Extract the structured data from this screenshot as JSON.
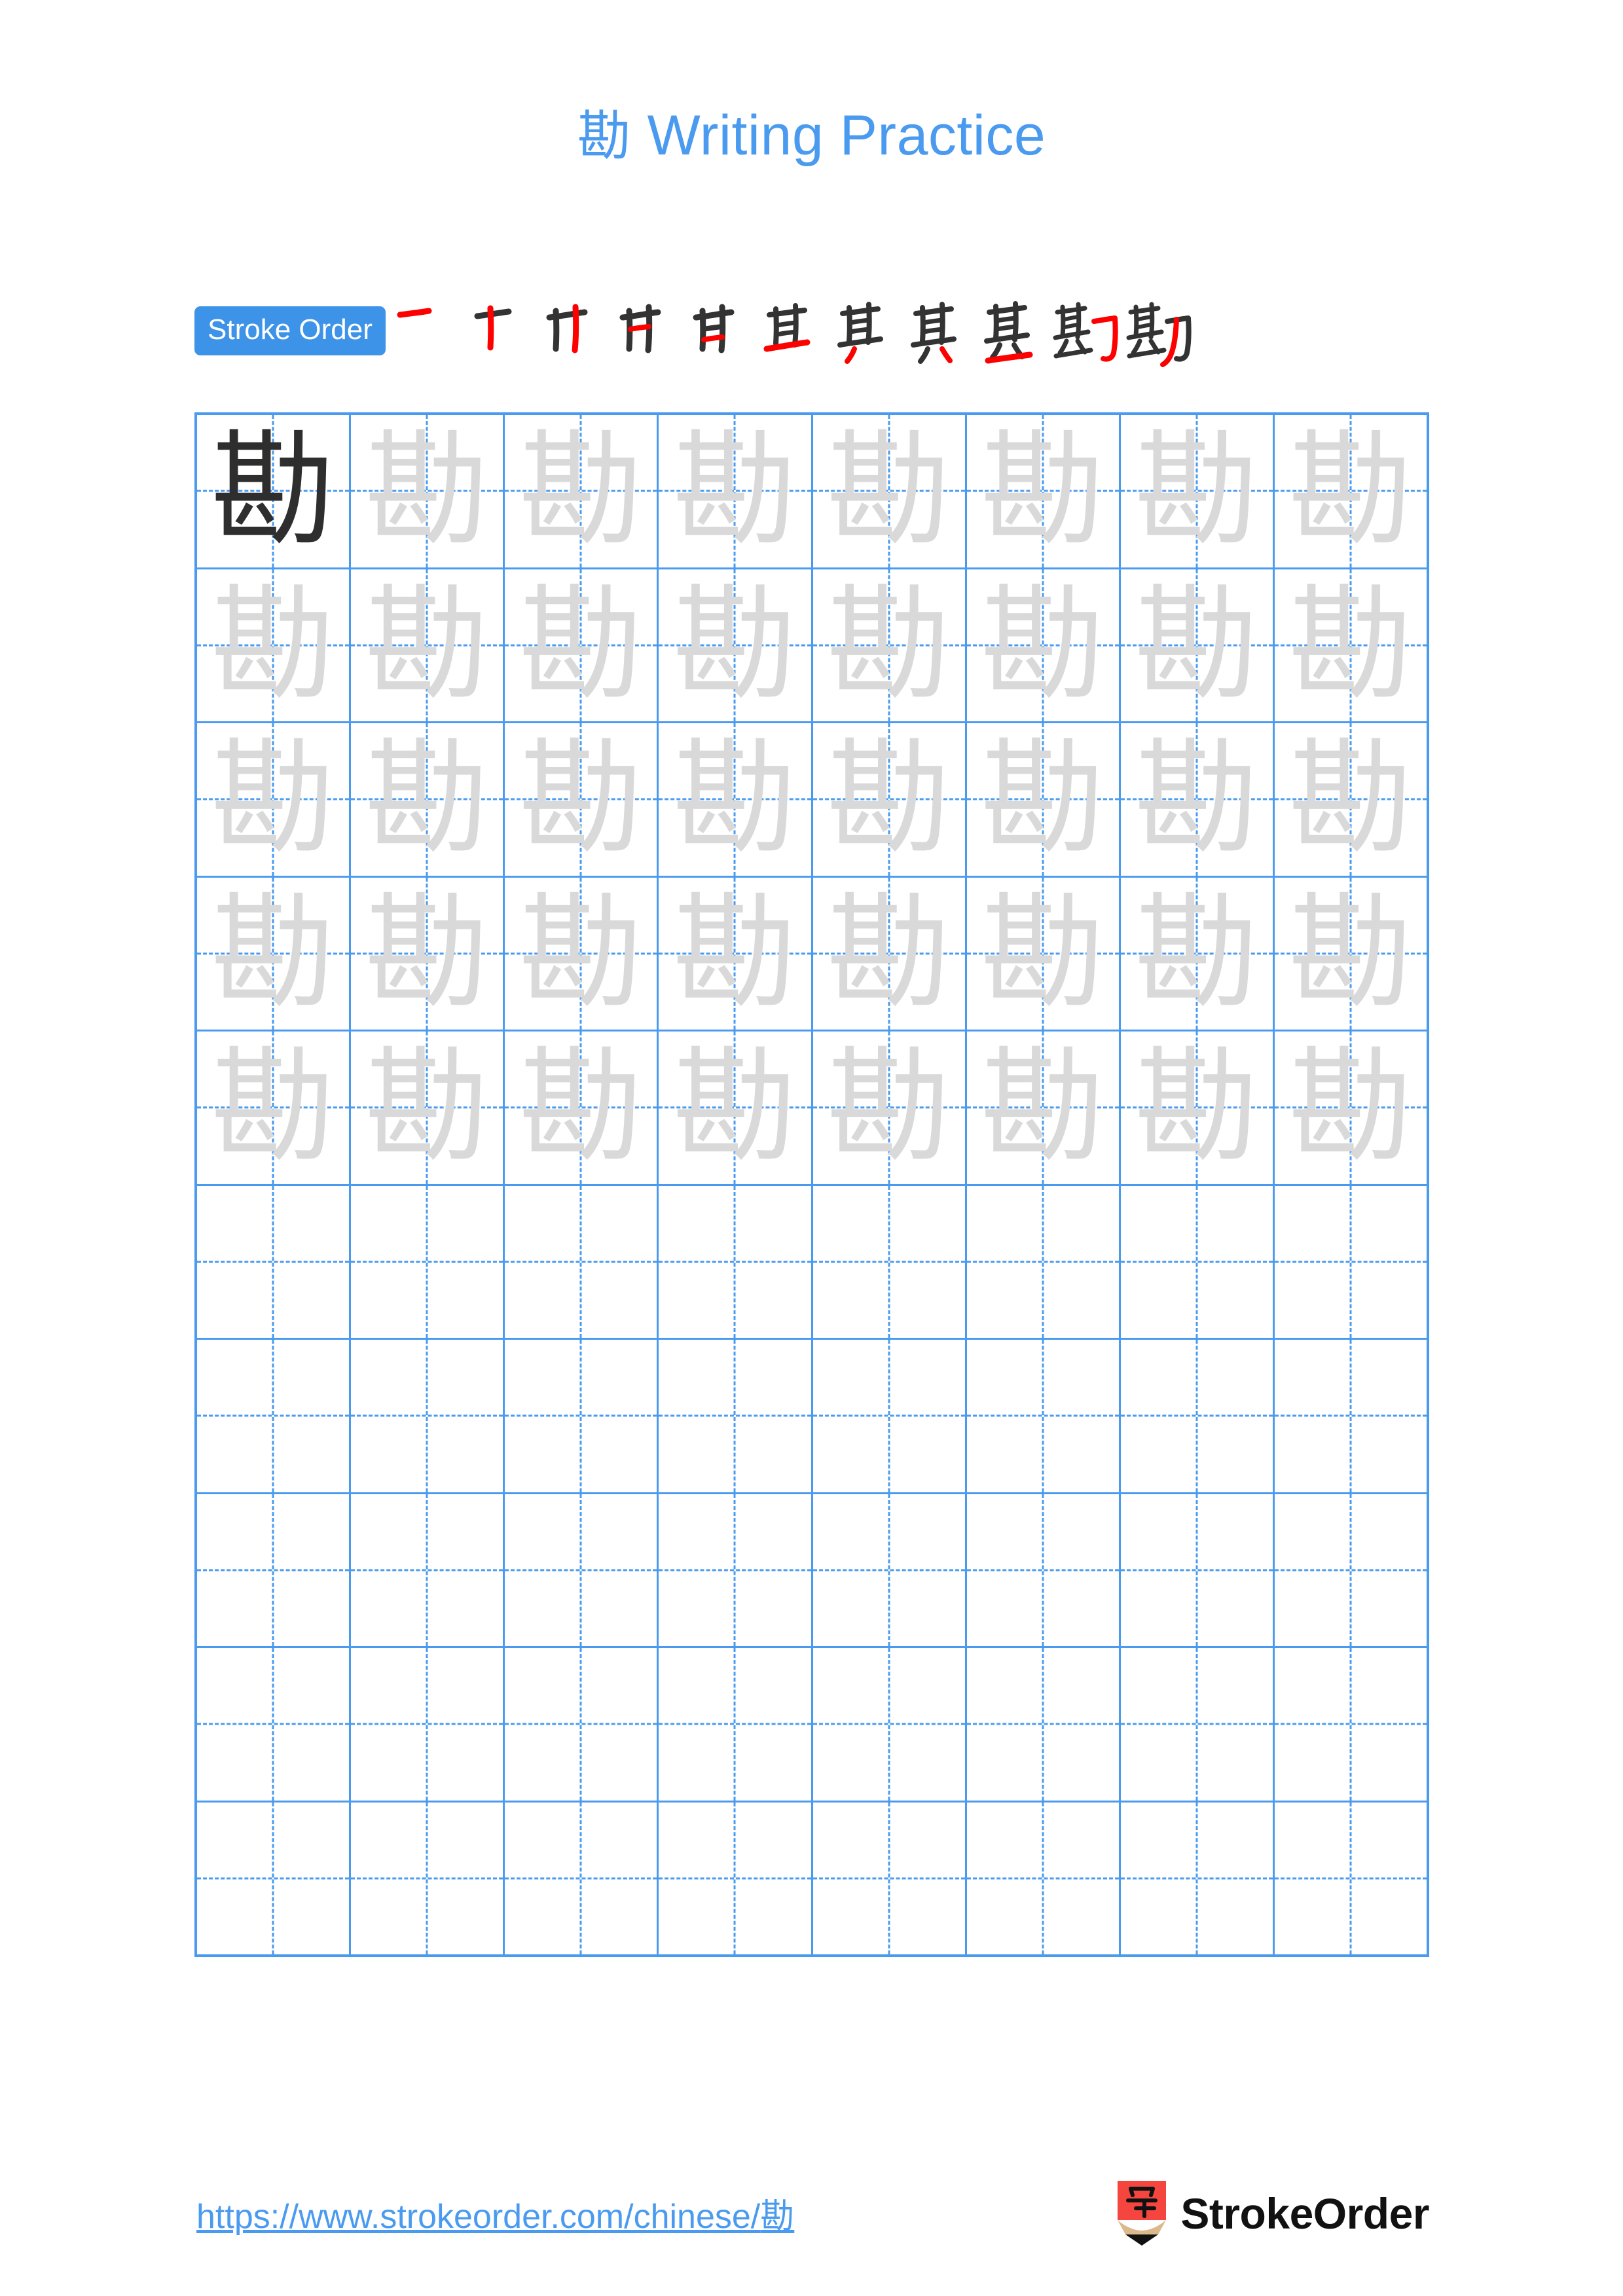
{
  "page": {
    "character": "勘",
    "title": "勘 Writing Practice",
    "title_char": "勘",
    "title_text": " Writing Practice",
    "background": "#ffffff",
    "accent_blue": "#4a9bf0",
    "badge_blue": "#3d93e8",
    "model_char_color": "#2e2e2e",
    "trace_char_color": "#d9d9d9",
    "new_stroke_color": "#ff0000",
    "prev_stroke_color": "#333333"
  },
  "stroke_order": {
    "label": "Stroke Order",
    "total_strokes": 11,
    "steps": [
      {
        "index": 1,
        "glyph": "一",
        "name": "heng"
      },
      {
        "index": 2,
        "glyph": "十",
        "name": "shu"
      },
      {
        "index": 3,
        "glyph": "卄",
        "name": "shu"
      },
      {
        "index": 4,
        "glyph": "艹",
        "name": "heng"
      },
      {
        "index": 5,
        "glyph": "甘",
        "name": "heng"
      },
      {
        "index": 6,
        "glyph": "甚",
        "name": "heng"
      },
      {
        "index": 7,
        "glyph": "其",
        "name": "pie"
      },
      {
        "index": 8,
        "glyph": "其",
        "name": "dian"
      },
      {
        "index": 9,
        "glyph": "甚",
        "name": "heng"
      },
      {
        "index": 10,
        "glyph": "勘",
        "name": "hengzhegou"
      },
      {
        "index": 11,
        "glyph": "勘",
        "name": "pie"
      }
    ]
  },
  "grid": {
    "columns": 8,
    "rows": 10,
    "filled_rows": 5,
    "empty_rows": 5,
    "model_cell": {
      "row": 0,
      "col": 0
    },
    "character": "勘"
  },
  "footer": {
    "url_prefix": "https://www.strokeorder.com/chinese/",
    "url_char": "勘",
    "url": "https://www.strokeorder.com/chinese/勘",
    "brand_name": "StrokeOrder",
    "logo_char": "字",
    "logo_body_color": "#f4453f",
    "logo_tip_color": "#dcb98c",
    "logo_point_color": "#111111"
  }
}
